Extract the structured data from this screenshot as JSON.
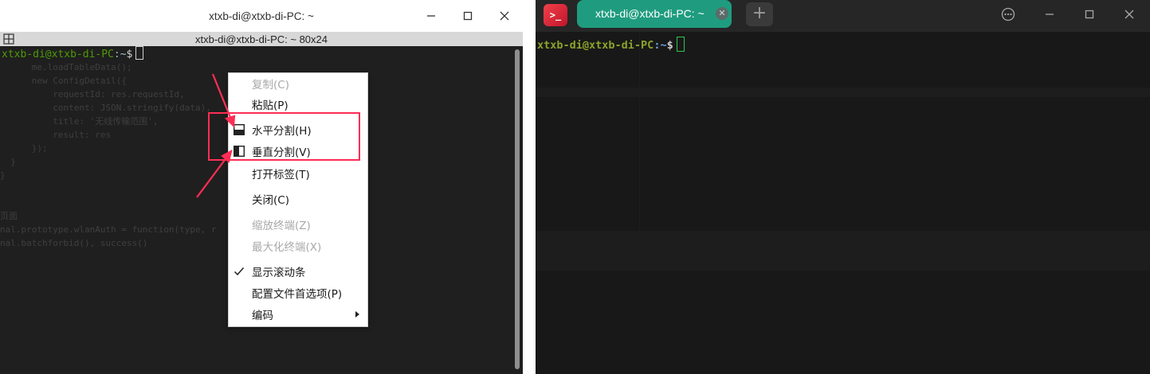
{
  "left_window": {
    "title": "xtxb-di@xtxb-di-PC: ~",
    "terminal_header": "xtxb-di@xtxb-di-PC: ~ 80x24",
    "prompt": {
      "user": "xtxb-di@xtxb-di-PC",
      "sep": ":",
      "path": "~",
      "dollar": "$"
    },
    "ghost_code_lines": [
      "      me.loadTableData();",
      "      new ConfigDetail({",
      "          requestId: res.requestId,",
      "          content: JSON.stringify(data),",
      "          title: '无线传输范围',",
      "          result: res",
      "      });",
      "  }",
      "}",
      "",
      "",
      "页面",
      "nal.prototype.wlanAuth = function(type, r",
      "nal.batchforbid(), success()"
    ]
  },
  "context_menu": {
    "items": [
      {
        "label": "复制(C)",
        "disabled": true
      },
      {
        "label": "粘贴(P)",
        "disabled": false
      },
      {
        "label": "水平分割(H)",
        "disabled": false,
        "icon": "split-horizontal-icon"
      },
      {
        "label": "垂直分割(V)",
        "disabled": false,
        "icon": "split-vertical-icon"
      },
      {
        "label": "打开标签(T)",
        "disabled": false
      },
      {
        "label": "关闭(C)",
        "disabled": false
      },
      {
        "label": "缩放终端(Z)",
        "disabled": true
      },
      {
        "label": "最大化终端(X)",
        "disabled": true
      },
      {
        "label": "显示滚动条",
        "disabled": false,
        "checked": true
      },
      {
        "label": "配置文件首选项(P)",
        "disabled": false
      },
      {
        "label": "编码",
        "disabled": false,
        "submenu": true
      }
    ]
  },
  "right_window": {
    "tab_label": "xtxb-di@xtxb-di-PC: ~",
    "prompt": {
      "user": "xtxb-di@xtxb-di-PC",
      "sep": ":",
      "path": "~",
      "dollar": "$"
    },
    "accent_color": "#1f9c7f"
  },
  "annotation_color": "#ff2d55"
}
